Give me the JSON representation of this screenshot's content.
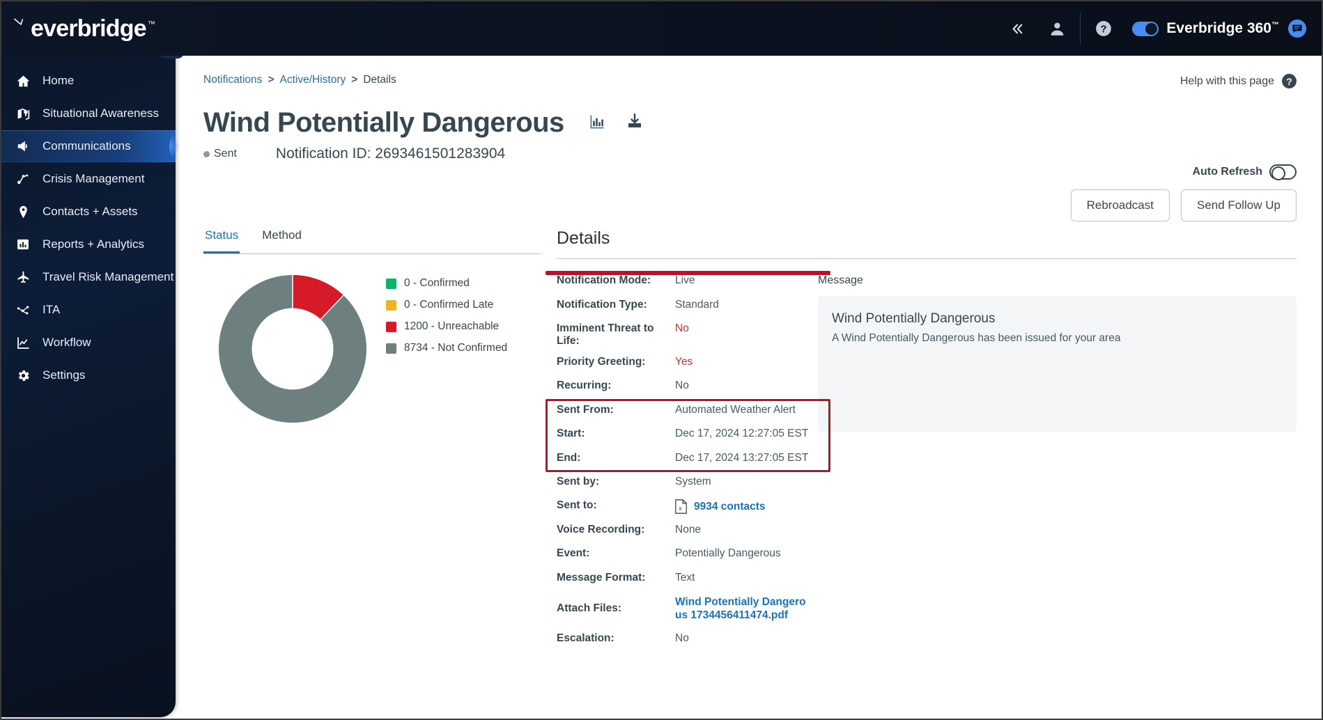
{
  "topbar": {
    "logo_text": "everbridge",
    "logo_tm": "™",
    "icons": [
      {
        "name": "collapse-chevrons-icon",
        "glyph": "«"
      },
      {
        "name": "user-icon",
        "glyph": "person"
      },
      {
        "name": "help-circle-icon",
        "glyph": "?"
      }
    ],
    "e360_label": "Everbridge 360",
    "e360_tm": "™",
    "chat_icon": "chat-icon"
  },
  "sidebar": {
    "collapse_glyph": "«",
    "items": [
      {
        "label": "Home",
        "icon": "home-icon",
        "active": false
      },
      {
        "label": "Situational Awareness",
        "icon": "map-pin-icon",
        "active": false
      },
      {
        "label": "Communications",
        "icon": "megaphone-icon",
        "active": true
      },
      {
        "label": "Crisis Management",
        "icon": "share-nodes-icon",
        "active": false
      },
      {
        "label": "Contacts + Assets",
        "icon": "location-pin-icon",
        "active": false
      },
      {
        "label": "Reports + Analytics",
        "icon": "bar-chart-icon",
        "active": false
      },
      {
        "label": "Travel Risk Management",
        "icon": "airplane-icon",
        "active": false
      },
      {
        "label": "ITA",
        "icon": "network-icon",
        "active": false
      },
      {
        "label": "Workflow",
        "icon": "line-chart-icon",
        "active": false
      },
      {
        "label": "Settings",
        "icon": "gear-icon",
        "active": false
      }
    ]
  },
  "breadcrumb": {
    "items": [
      "Notifications",
      "Active/History",
      "Details"
    ],
    "separator": ">"
  },
  "help": {
    "label": "Help with this page",
    "icon": "question-mark-icon"
  },
  "header": {
    "title": "Wind Potentially Dangerous",
    "chart_icon": "bar-chart-icon",
    "download_icon": "download-icon",
    "status": "Sent",
    "notification_id": "Notification ID: 2693461501283904"
  },
  "auto_refresh": {
    "label": "Auto Refresh",
    "state": "off"
  },
  "actions": {
    "rebroadcast": "Rebroadcast",
    "send_follow_up": "Send Follow Up"
  },
  "tabs": [
    {
      "label": "Status",
      "active": true
    },
    {
      "label": "Method",
      "active": false
    }
  ],
  "details": {
    "section_title": "Details",
    "rows": [
      {
        "label": "Notification Mode:",
        "value": "Live",
        "style": "plain"
      },
      {
        "label": "Notification Type:",
        "value": "Standard",
        "style": "plain"
      },
      {
        "label": "Imminent Threat to Life:",
        "value": "No",
        "style": "red"
      },
      {
        "label": "Priority Greeting:",
        "value": "Yes",
        "style": "red"
      },
      {
        "label": "Recurring:",
        "value": "No",
        "style": "plain"
      },
      {
        "label": "Sent From:",
        "value": "Automated Weather Alert",
        "style": "plain"
      },
      {
        "label": "Start:",
        "value": "Dec 17, 2024 12:27:05 EST",
        "style": "plain"
      },
      {
        "label": "End:",
        "value": "Dec 17, 2024 13:27:05 EST",
        "style": "plain"
      },
      {
        "label": "Sent by:",
        "value": "System",
        "style": "plain"
      },
      {
        "label": "Sent to:",
        "value": "9934  contacts",
        "style": "link-xls"
      },
      {
        "label": "Voice Recording:",
        "value": "None",
        "style": "plain"
      },
      {
        "label": "Event:",
        "value": "Potentially Dangerous",
        "style": "plain"
      },
      {
        "label": "Message Format:",
        "value": "Text",
        "style": "plain"
      },
      {
        "label": "Attach Files:",
        "value": "Wind Potentially Dangero us 1734456411474.pdf",
        "style": "link"
      },
      {
        "label": "Escalation:",
        "value": "No",
        "style": "plain"
      }
    ],
    "highlight_color": "#b3142a"
  },
  "message": {
    "label": "Message",
    "title": "Wind Potentially Dangerous",
    "body": "A Wind Potentially Dangerous has been issued for your area"
  },
  "chart_data": {
    "type": "pie",
    "title": "Status",
    "categories": [
      "0 - Confirmed",
      "0 - Confirmed Late",
      "1200 - Unreachable",
      "8734 - Not Confirmed"
    ],
    "values": [
      0,
      0,
      1200,
      8734
    ],
    "colors": [
      "#0fb26a",
      "#f0b323",
      "#d71a28",
      "#6e7f7f"
    ],
    "legend_position": "right",
    "donut": true,
    "inner_radius_ratio": 0.55,
    "total": 9934
  }
}
